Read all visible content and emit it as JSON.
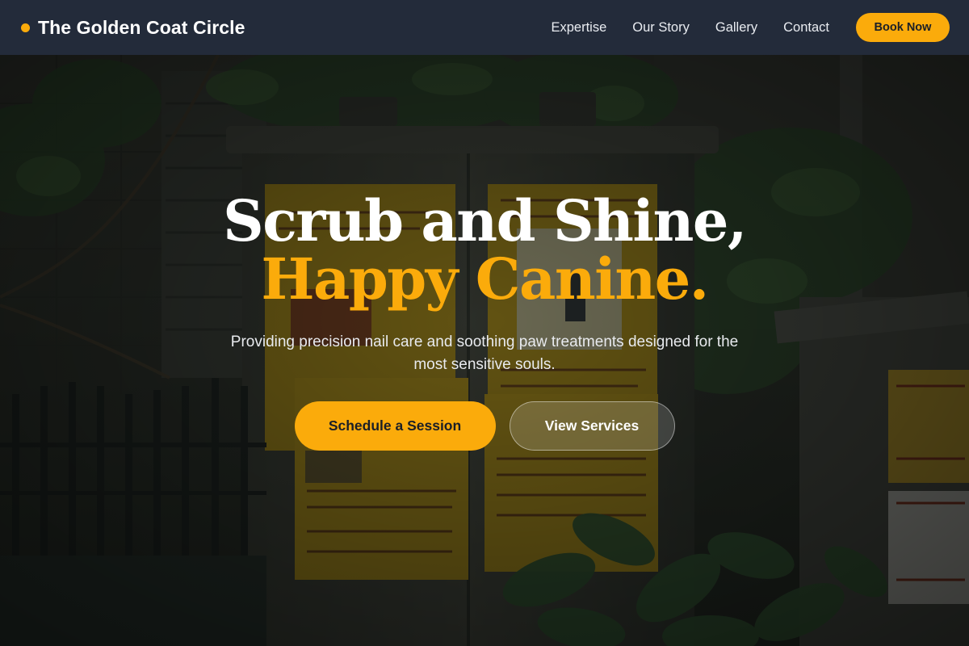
{
  "brand": {
    "name": "The Golden Coat Circle",
    "accent": "#fbab0b"
  },
  "nav": {
    "links": [
      "Expertise",
      "Our Story",
      "Gallery",
      "Contact"
    ],
    "cta": "Book Now"
  },
  "hero": {
    "headline_line1": "Scrub and Shine,",
    "headline_line2": "Happy Canine.",
    "subtitle": "Providing precision nail care and soothing paw treatments designed for the most sensitive souls.",
    "primary_cta": "Schedule a Session",
    "secondary_cta": "View Services",
    "background": "photo of a weathered utility box covered in posters, surrounded by green plants"
  },
  "colors": {
    "navbar": "#232b3a",
    "accent": "#fbab0b",
    "text_light": "#ffffff"
  }
}
